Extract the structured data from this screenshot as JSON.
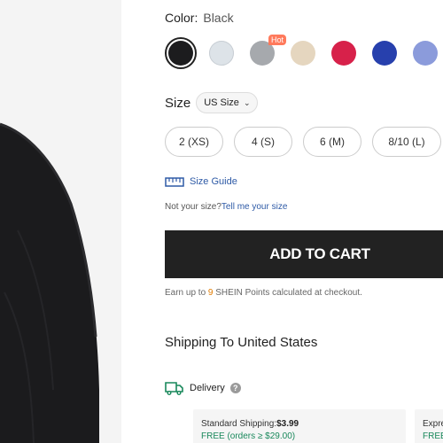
{
  "color": {
    "label": "Color:",
    "value": "Black"
  },
  "swatches": [
    {
      "name": "black",
      "hex": "#1c1c1e",
      "selected": true
    },
    {
      "name": "light-gray",
      "hex": "#dde3e8",
      "selected": false
    },
    {
      "name": "heather-gray",
      "hex": "#a6a9ad",
      "selected": false,
      "badge": "Hot"
    },
    {
      "name": "beige",
      "hex": "#e5d6bf",
      "selected": false
    },
    {
      "name": "red",
      "hex": "#d7214a",
      "selected": false
    },
    {
      "name": "blue",
      "hex": "#2740ad",
      "selected": false
    },
    {
      "name": "light-blue",
      "hex": "#8b9bdb",
      "selected": false
    }
  ],
  "size": {
    "label": "Size",
    "select_value": "US Size"
  },
  "sizes": [
    "2 (XS)",
    "4 (S)",
    "6 (M)",
    "8/10 (L)"
  ],
  "size_guide": "Size Guide",
  "not_size": {
    "prefix": "Not your size?",
    "link": "Tell me your size"
  },
  "add_to_cart": "ADD TO CART",
  "points": {
    "prefix": "Earn up to ",
    "num": "9",
    "suffix": " SHEIN Points calculated at checkout."
  },
  "shipping_title": "Shipping To United States",
  "delivery": {
    "label": "Delivery",
    "help": "?"
  },
  "shipping_options": [
    {
      "name": "Standard Shipping:",
      "price": "$3.99",
      "free": "FREE (orders ≥ $29.00)"
    },
    {
      "name": "Expre",
      "price": "",
      "free": "FREE"
    }
  ],
  "colors": {
    "accent_link": "#2e5aa6",
    "button_bg": "#222222",
    "points_highlight": "#e07b00",
    "hot_badge": "#ff7a5c",
    "free_text": "#19885b"
  }
}
